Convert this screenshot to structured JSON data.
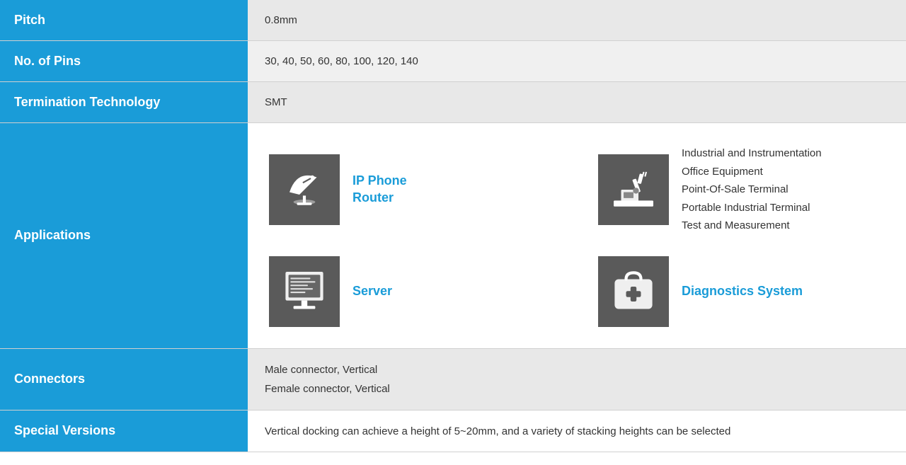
{
  "rows": {
    "pitch": {
      "label": "Pitch",
      "value": "0.8mm"
    },
    "no_of_pins": {
      "label": "No. of Pins",
      "value": "30, 40, 50, 60, 80, 100, 120, 140"
    },
    "termination_technology": {
      "label": "Termination Technology",
      "value": "SMT"
    },
    "applications": {
      "label": "Applications",
      "items": [
        {
          "icon": "satellite",
          "label": "IP Phone\nRouter",
          "multi": false
        },
        {
          "icon": "industrial",
          "label": "Industrial and Instrumentation\nOffice Equipment\nPoint-Of-Sale Terminal\nPortable Industrial Terminal\nTest and Measurement",
          "multi": true
        },
        {
          "icon": "server",
          "label": "Server",
          "multi": false
        },
        {
          "icon": "diagnostics",
          "label": "Diagnostics System",
          "multi": false
        }
      ]
    },
    "connectors": {
      "label": "Connectors",
      "line1": "Male connector, Vertical",
      "line2": "Female connector, Vertical"
    },
    "special_versions": {
      "label": "Special Versions",
      "value": "Vertical docking can achieve a height of 5~20mm, and a variety of stacking heights can be selected"
    }
  }
}
